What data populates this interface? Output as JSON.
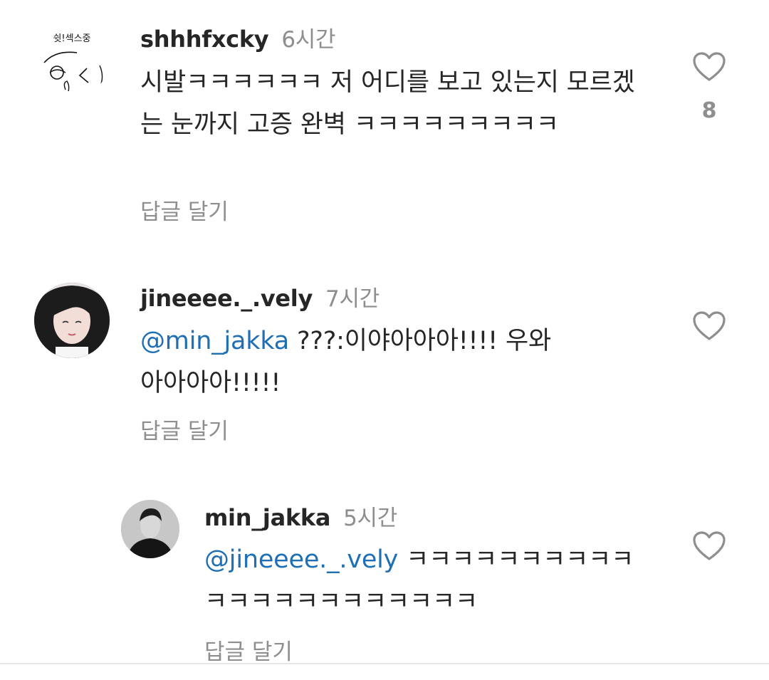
{
  "comments": [
    {
      "username": "shhhfxcky",
      "time": "6시간",
      "avatar_text": "쉿!섹스중",
      "text": "시발ㅋㅋㅋㅋㅋㅋ 저 어디를 보고 있는지 모르겠는 눈까지 고증 완벽 ㅋㅋㅋㅋㅋㅋㅋㅋㅋ",
      "likes": "8",
      "reply_label": "답글 달기"
    },
    {
      "username": "jineeee._.vely",
      "time": "7시간",
      "mention": "@min_jakka",
      "text": " ???:이야아아아!!!! 우와아아아아!!!!!",
      "reply_label": "답글 달기"
    },
    {
      "username": "min_jakka",
      "time": "5시간",
      "mention": "@jineeee._.vely",
      "text": " ㅋㅋㅋㅋㅋㅋㅋㅋㅋㅋㅋㅋㅋㅋㅋㅋㅋㅋㅋㅋㅋㅋ",
      "reply_label": "답글 달기"
    }
  ],
  "colors": {
    "mention": "#1f6fb5",
    "muted": "#8e8e8e",
    "text": "#262626"
  },
  "icons": {
    "like": "heart-outline-icon"
  }
}
